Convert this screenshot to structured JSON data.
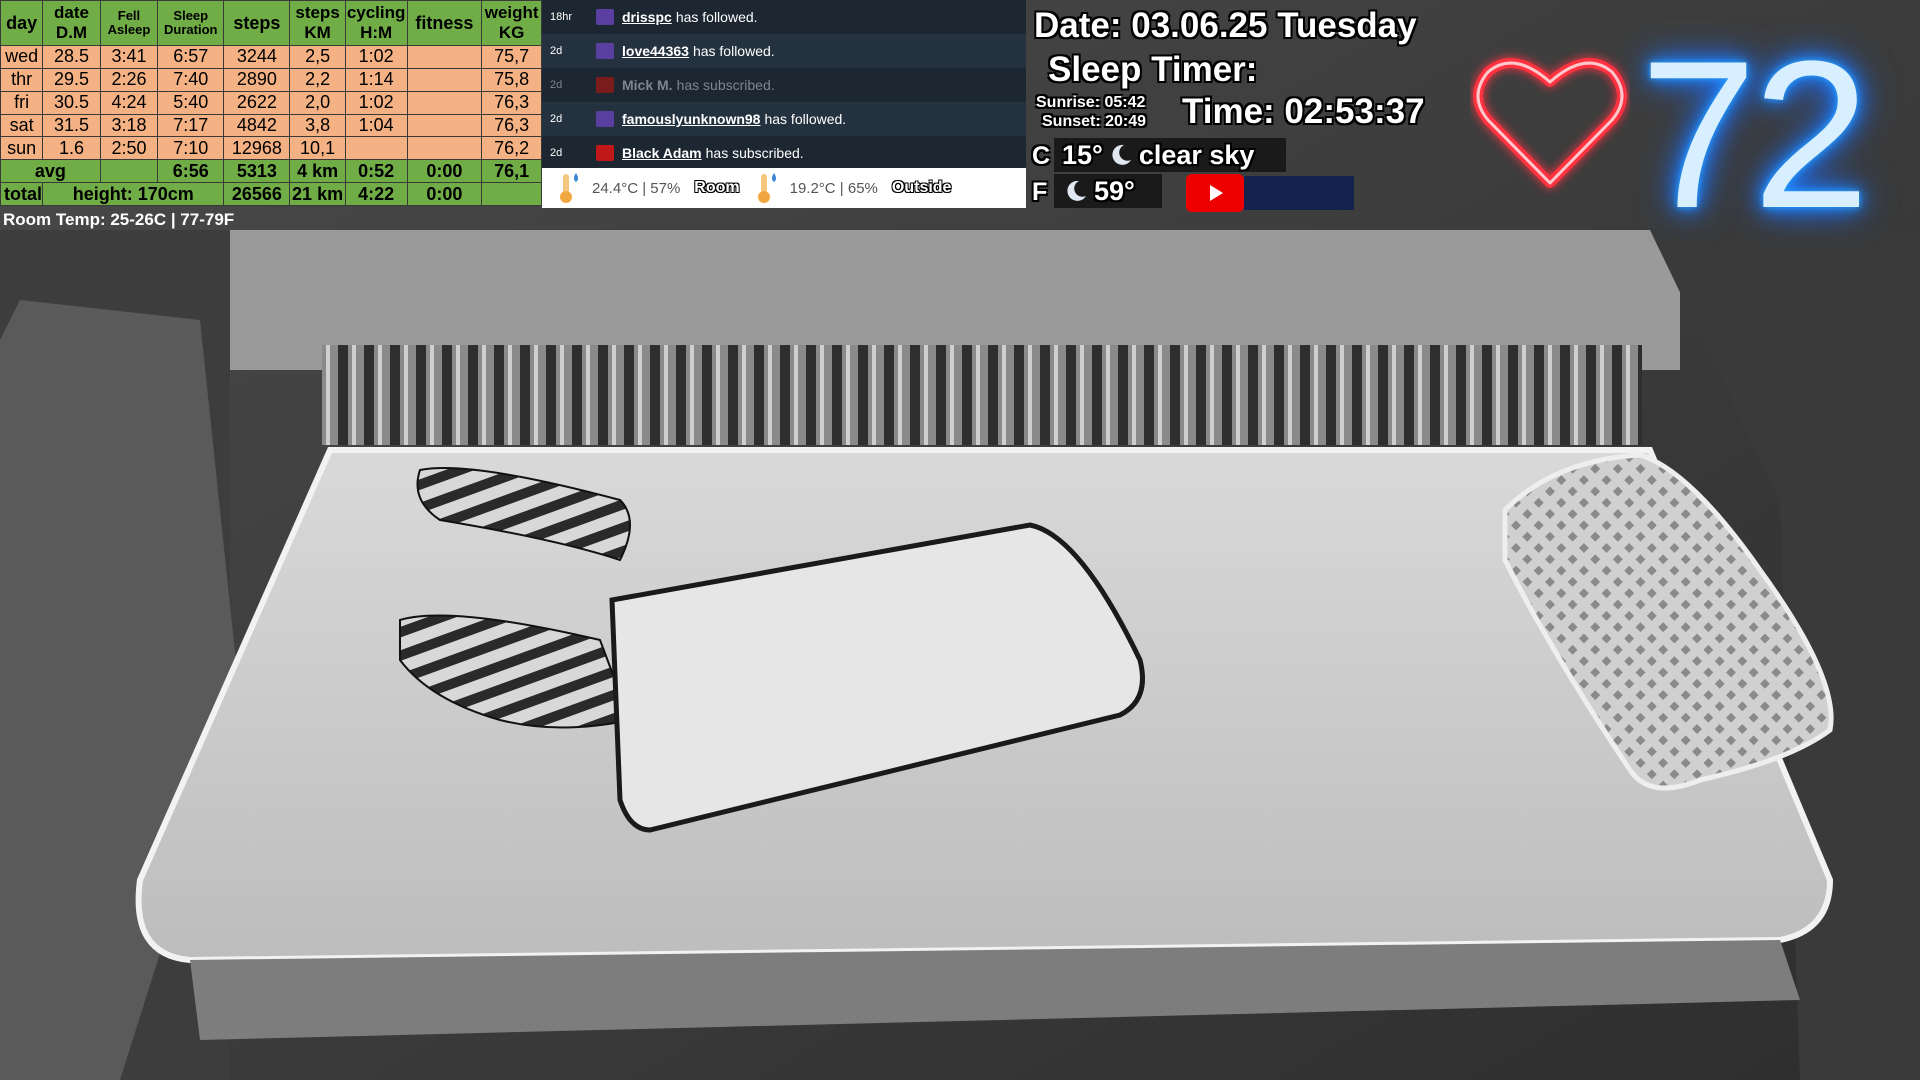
{
  "stats": {
    "headers": [
      {
        "big": "day"
      },
      {
        "top": "date",
        "bottom": "D.M"
      },
      {
        "top": "Fell",
        "bottom": "Asleep"
      },
      {
        "top": "Sleep",
        "bottom": "Duration"
      },
      {
        "big": "steps"
      },
      {
        "top": "steps",
        "bottom": "KM"
      },
      {
        "top": "cycling",
        "bottom": "H:M"
      },
      {
        "big": "fitness"
      },
      {
        "top": "weight",
        "bottom": "KG"
      }
    ],
    "rows": [
      {
        "day": "wed",
        "date": "28.5",
        "fell": "3:41",
        "duration": "6:57",
        "steps": "3244",
        "km": "2,5",
        "cycling": "1:02",
        "fitness": "",
        "weight": "75,7"
      },
      {
        "day": "thr",
        "date": "29.5",
        "fell": "2:26",
        "duration": "7:40",
        "steps": "2890",
        "km": "2,2",
        "cycling": "1:14",
        "fitness": "",
        "weight": "75,8"
      },
      {
        "day": "fri",
        "date": "30.5",
        "fell": "4:24",
        "duration": "5:40",
        "steps": "2622",
        "km": "2,0",
        "cycling": "1:02",
        "fitness": "",
        "weight": "76,3"
      },
      {
        "day": "sat",
        "date": "31.5",
        "fell": "3:18",
        "duration": "7:17",
        "steps": "4842",
        "km": "3,8",
        "cycling": "1:04",
        "fitness": "",
        "weight": "76,3"
      },
      {
        "day": "sun",
        "date": "1.6",
        "fell": "2:50",
        "duration": "7:10",
        "steps": "12968",
        "km": "10,1",
        "cycling": "",
        "fitness": "",
        "weight": "76,2"
      }
    ],
    "avg": {
      "label": "avg",
      "duration": "6:56",
      "steps": "5313",
      "km": "4 km",
      "cycling": "0:52",
      "fitness": "0:00",
      "weight": "76,1"
    },
    "total": {
      "label": "total",
      "height": "height: 170cm",
      "steps": "26566",
      "km": "21 km",
      "cycling": "4:22",
      "fitness": "0:00"
    },
    "room_temp": "Room Temp: 25-26C | 77-79F"
  },
  "feed": [
    {
      "time": "18hr",
      "user": "drisspc",
      "action": "has followed.",
      "badge": "#5b3fa0",
      "dim": false
    },
    {
      "time": "2d",
      "user": "love44363",
      "action": "has followed.",
      "badge": "#5b3fa0",
      "dim": false
    },
    {
      "time": "2d",
      "user": "Mick M.",
      "action": "has subscribed.",
      "badge": "#7a1c1c",
      "dim": true
    },
    {
      "time": "2d",
      "user": "famouslyunknown98",
      "action": "has followed.",
      "badge": "#5b3fa0",
      "dim": false
    },
    {
      "time": "2d",
      "user": "Black Adam",
      "action": "has subscribed.",
      "badge": "#c01818",
      "dim": false
    }
  ],
  "temps": {
    "room_value": "24.4°C | 57%",
    "room_label": "Room",
    "outside_value": "19.2°C | 65%",
    "outside_label": "Outside"
  },
  "info": {
    "date": "Date: 03.06.25 Tuesday",
    "sleep_timer": "Sleep Timer:",
    "sunrise": "Sunrise: 05:42",
    "sunset": "Sunset: 20:49",
    "time": "Time: 02:53:37",
    "c_label": "C",
    "c_temp": "15°",
    "condition": "clear sky",
    "f_label": "F",
    "f_temp": "59°"
  },
  "heart_rate": "72",
  "colors": {
    "header_green": "#70ad47",
    "row_orange": "#f4b183",
    "heart_red": "#ff2a3a",
    "bpm_blue": "#1e90ff",
    "youtube_red": "#ee0000"
  },
  "icons": [
    "thermometer-icon",
    "moon-icon",
    "youtube-icon",
    "heart-icon"
  ]
}
